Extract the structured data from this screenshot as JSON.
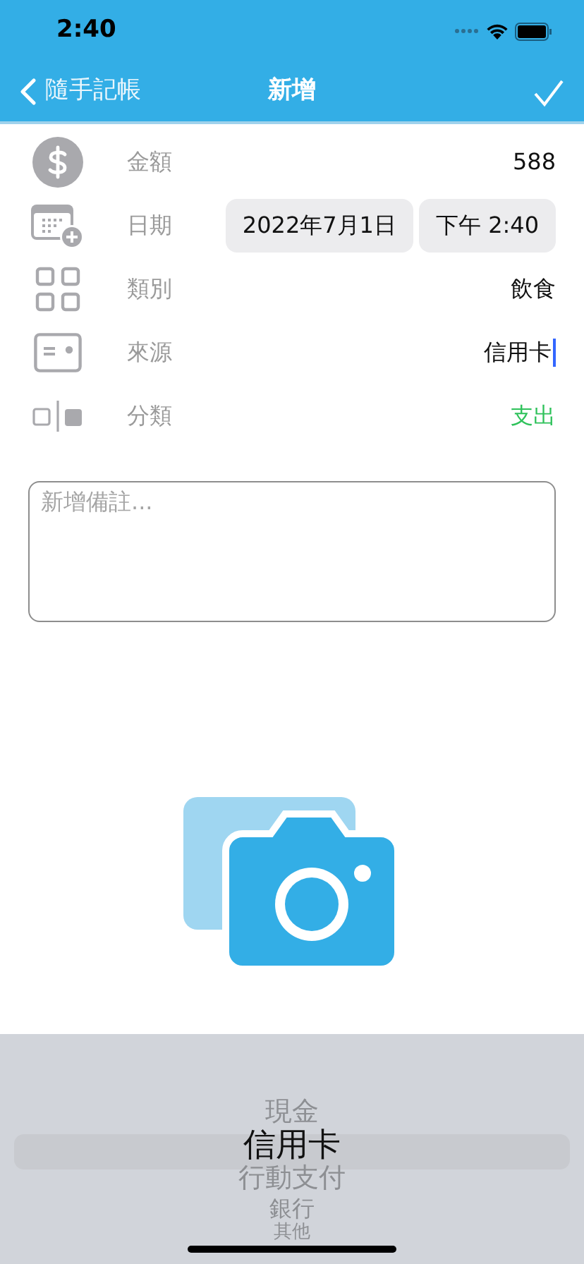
{
  "status_bar": {
    "time": "2:40"
  },
  "nav": {
    "back": "隨手記帳",
    "title": "新增"
  },
  "fields": [
    {
      "kind": "amount",
      "label": "金額",
      "value": "588"
    },
    {
      "kind": "date",
      "label": "日期",
      "date": "2022年7月1日",
      "time": "下午 2:40"
    },
    {
      "kind": "category",
      "label": "類別",
      "value": "飲食"
    },
    {
      "kind": "source",
      "label": "來源",
      "value": "信用卡",
      "focused": true
    },
    {
      "kind": "type",
      "label": "分類",
      "value": "支出"
    }
  ],
  "note": {
    "placeholder": "新增備註..."
  },
  "photo": {
    "kind": "camera"
  },
  "picker": [
    {
      "label": "現金",
      "selected": false
    },
    {
      "label": "信用卡",
      "selected": true
    },
    {
      "label": "行動支付",
      "selected": false
    },
    {
      "label": "銀行",
      "selected": false
    },
    {
      "label": "其他",
      "selected": false
    }
  ]
}
